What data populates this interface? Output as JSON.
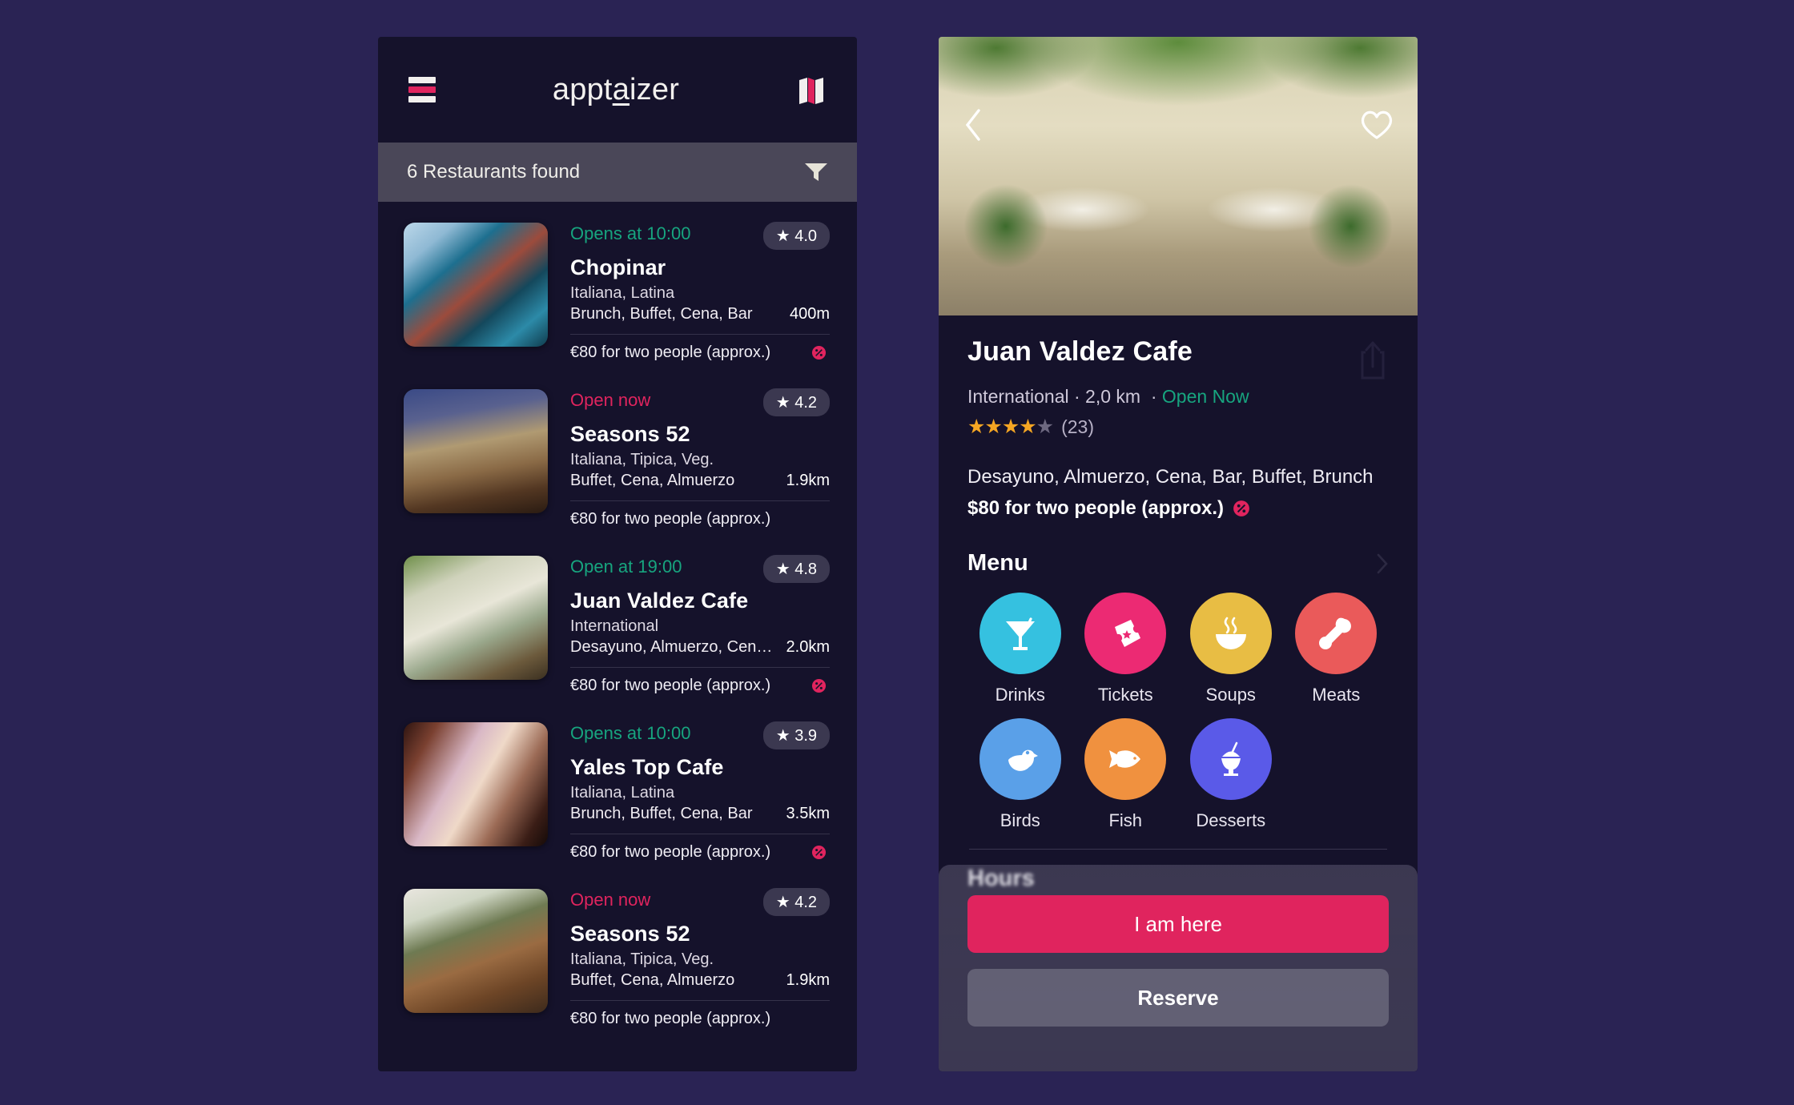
{
  "app": {
    "brand_before": "appt",
    "brand_accent": "a",
    "brand_after": "izer",
    "menu_icon": "hamburger-icon",
    "map_icon": "map-icon"
  },
  "filter_bar": {
    "count_label": "6 Restaurants found",
    "filter_icon": "funnel-icon"
  },
  "colors": {
    "page_bg": "#2a2354",
    "panel_bg": "#15122b",
    "accent_pink": "#e0245e",
    "accent_green": "#17a57f",
    "filter_bar_bg": "#4a4758",
    "badge_bg": "#3b3850",
    "star_orange": "#f5a623"
  },
  "restaurants": [
    {
      "status": "Opens at 10:00",
      "status_type": "green",
      "rating": "★ 4.0",
      "name": "Chopinar",
      "cuisine": "Italiana, Latina",
      "meals": "Brunch, Buffet, Cena, Bar",
      "distance": "400m",
      "price": "€80 for two people (approx.)",
      "has_discount": true
    },
    {
      "status": "Open now",
      "status_type": "pink",
      "rating": "★ 4.2",
      "name": "Seasons 52",
      "cuisine": "Italiana, Tipica, Veg.",
      "meals": "Buffet, Cena, Almuerzo",
      "distance": "1.9km",
      "price": "€80 for two people (approx.)",
      "has_discount": false
    },
    {
      "status": "Open at 19:00",
      "status_type": "green",
      "rating": "★ 4.8",
      "name": "Juan Valdez Cafe",
      "cuisine": "International",
      "meals": "Desayuno, Almuerzo, Cena…",
      "distance": "2.0km",
      "price": "€80 for two people (approx.)",
      "has_discount": true
    },
    {
      "status": "Opens at 10:00",
      "status_type": "green",
      "rating": "★ 3.9",
      "name": "Yales Top Cafe",
      "cuisine": "Italiana, Latina",
      "meals": "Brunch, Buffet, Cena, Bar",
      "distance": "3.5km",
      "price": "€80 for two people (approx.)",
      "has_discount": true
    },
    {
      "status": "Open now",
      "status_type": "pink",
      "rating": "★ 4.2",
      "name": "Seasons 52",
      "cuisine": "Italiana, Tipica, Veg.",
      "meals": "Buffet, Cena, Almuerzo",
      "distance": "1.9km",
      "price": "€80 for two people (approx.)",
      "has_discount": false
    }
  ],
  "detail": {
    "back_icon": "chevron-left-icon",
    "favorite_icon": "heart-outline-icon",
    "share_icon": "share-icon",
    "title": "Juan Valdez Cafe",
    "cuisine": "International",
    "distance": "2,0 km",
    "open_status": "Open Now",
    "meta_separator": "·",
    "stars_filled": 4,
    "stars_total": 5,
    "reviews": "(23)",
    "tags": "Desayuno, Almuerzo, Cena, Bar, Buffet, Brunch",
    "price": "$80 for two people (approx.)",
    "menu_section_title": "Menu",
    "menu_more_icon": "chevron-right-icon",
    "hours_section_title": "Hours",
    "categories": [
      {
        "label": "Drinks",
        "icon": "cocktail-icon",
        "color": "#35c1e0"
      },
      {
        "label": "Tickets",
        "icon": "ticket-icon",
        "color": "#ec2a73"
      },
      {
        "label": "Soups",
        "icon": "soup-bowl-icon",
        "color": "#e8bd44"
      },
      {
        "label": "Meats",
        "icon": "drumstick-icon",
        "color": "#ea5a5a"
      },
      {
        "label": "Birds",
        "icon": "bird-icon",
        "color": "#5aa0e8"
      },
      {
        "label": "Fish",
        "icon": "fish-icon",
        "color": "#f0913f"
      },
      {
        "label": "Desserts",
        "icon": "sundae-icon",
        "color": "#5a5ae8"
      }
    ],
    "primary_button": "I am here",
    "secondary_button": "Reserve"
  }
}
